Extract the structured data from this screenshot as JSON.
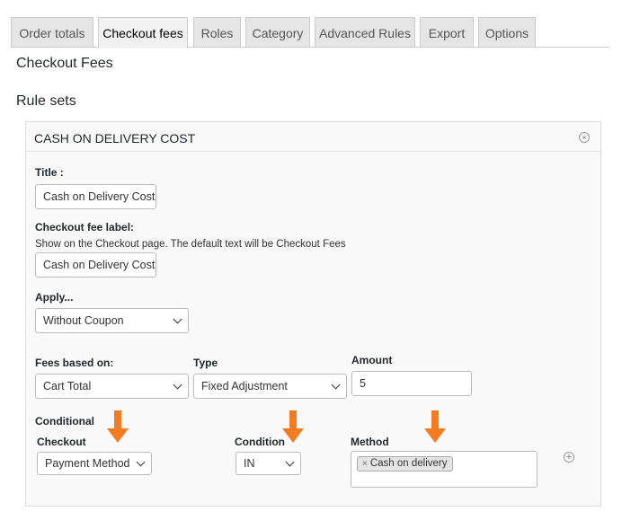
{
  "tabs": [
    {
      "label": "Order totals",
      "active": false
    },
    {
      "label": "Checkout fees",
      "active": true
    },
    {
      "label": "Roles",
      "active": false
    },
    {
      "label": "Category",
      "active": false
    },
    {
      "label": "Advanced Rules",
      "active": false
    },
    {
      "label": "Export",
      "active": false
    },
    {
      "label": "Options",
      "active": false
    }
  ],
  "page": {
    "heading": "Checkout Fees",
    "subheading": "Rule sets"
  },
  "rule": {
    "title": "CASH ON DELIVERY COST",
    "title_label": "Title :",
    "title_value": "Cash on Delivery Cost",
    "fee_label_label": "Checkout fee label:",
    "fee_label_desc": "Show on the Checkout page. The default text will be Checkout Fees",
    "fee_label_value": "Cash on Delivery Cost",
    "apply_label": "Apply...",
    "apply_value": "Without Coupon",
    "fees_based_label": "Fees based on:",
    "fees_based_value": "Cart Total",
    "type_label": "Type",
    "type_value": "Fixed Adjustment",
    "amount_label": "Amount",
    "amount_value": "5",
    "conditional_label": "Conditional",
    "checkout_label": "Checkout",
    "checkout_value": "Payment Method",
    "condition_label": "Condition",
    "condition_value": "IN",
    "method_label": "Method",
    "method_tags": [
      "Cash on delivery"
    ],
    "tag_remove_symbol": "×",
    "remove_symbol": "×",
    "add_symbol": "+"
  },
  "colors": {
    "arrow": "#f47b20",
    "tab_active": "#f1f1f1",
    "tab_inactive": "#e5e5e5",
    "panel_bg": "#f9f9f9"
  }
}
